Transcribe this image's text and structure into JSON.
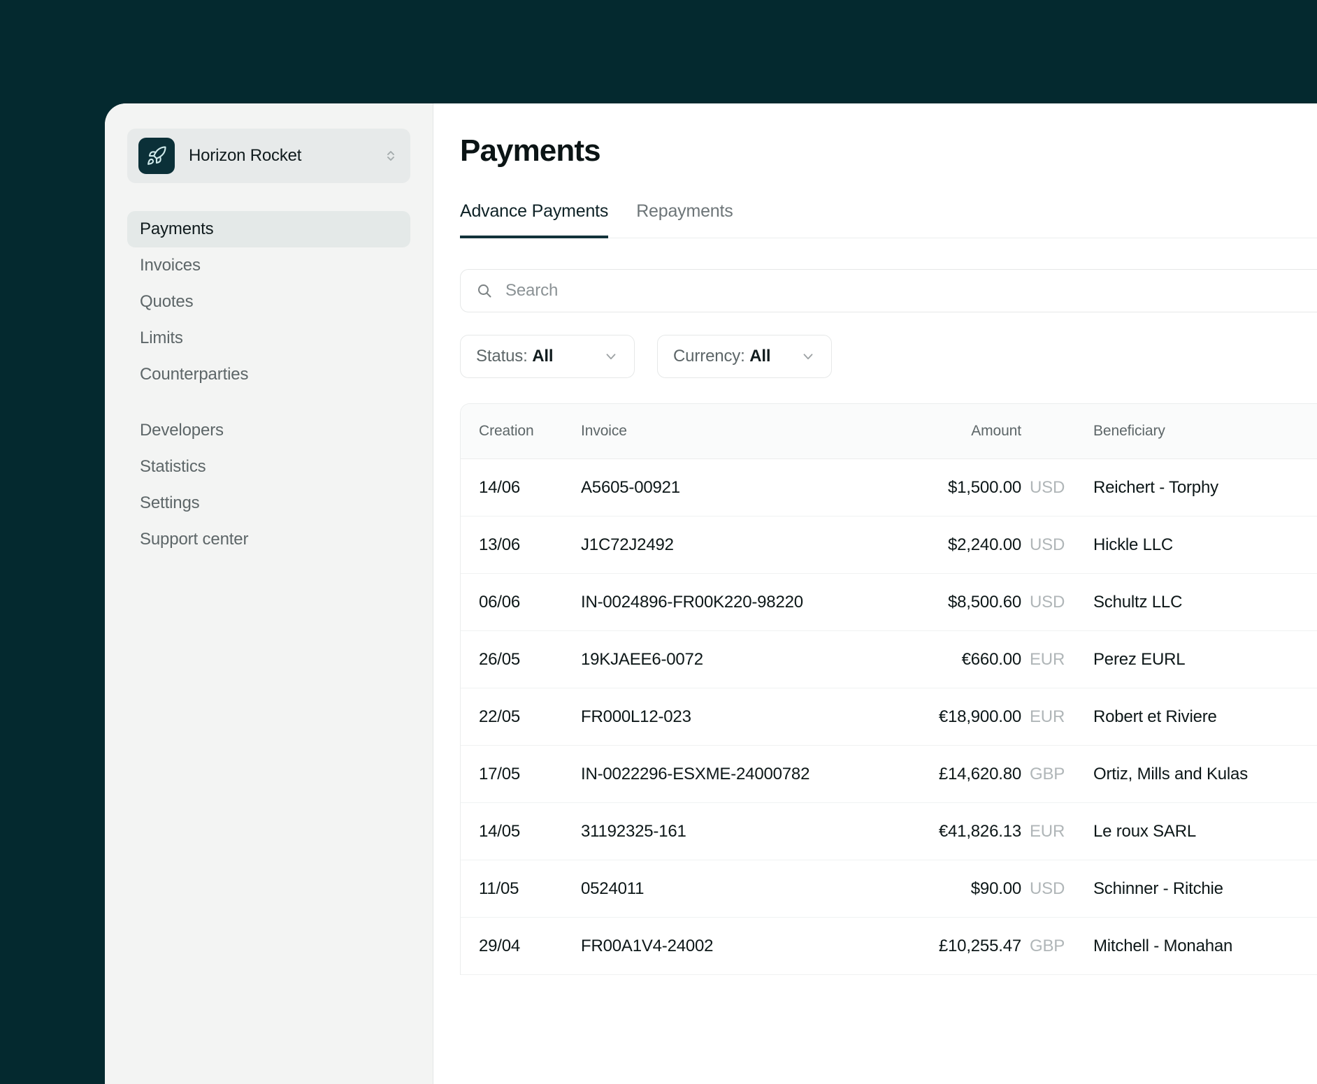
{
  "workspace": {
    "name": "Horizon Rocket",
    "logo_icon": "rocket-icon",
    "switch_icon": "chevron-up-down-icon"
  },
  "sidebar": {
    "primary_items": [
      {
        "label": "Payments",
        "active": true
      },
      {
        "label": "Invoices",
        "active": false
      },
      {
        "label": "Quotes",
        "active": false
      },
      {
        "label": "Limits",
        "active": false
      },
      {
        "label": "Counterparties",
        "active": false
      }
    ],
    "secondary_items": [
      {
        "label": "Developers"
      },
      {
        "label": "Statistics"
      },
      {
        "label": "Settings"
      },
      {
        "label": "Support center"
      }
    ]
  },
  "main": {
    "title": "Payments",
    "tabs": [
      {
        "label": "Advance Payments",
        "active": true
      },
      {
        "label": "Repayments",
        "active": false
      }
    ],
    "search": {
      "placeholder": "Search",
      "value": "",
      "icon": "search-icon"
    },
    "filters": [
      {
        "prefix": "Status: ",
        "value": "All",
        "icon": "chevron-down-icon"
      },
      {
        "prefix": "Currency: ",
        "value": "All",
        "icon": "chevron-down-icon"
      }
    ],
    "table": {
      "columns": [
        "Creation",
        "Invoice",
        "Amount",
        "Beneficiary"
      ],
      "rows": [
        {
          "creation": "14/06",
          "invoice": "A5605-00921",
          "amount": "$1,500.00",
          "currency": "USD",
          "beneficiary": "Reichert - Torphy"
        },
        {
          "creation": "13/06",
          "invoice": "J1C72J2492",
          "amount": "$2,240.00",
          "currency": "USD",
          "beneficiary": "Hickle LLC"
        },
        {
          "creation": "06/06",
          "invoice": "IN-0024896-FR00K220-98220",
          "amount": "$8,500.60",
          "currency": "USD",
          "beneficiary": "Schultz LLC"
        },
        {
          "creation": "26/05",
          "invoice": "19KJAEE6-0072",
          "amount": "€660.00",
          "currency": "EUR",
          "beneficiary": "Perez EURL"
        },
        {
          "creation": "22/05",
          "invoice": "FR000L12-023",
          "amount": "€18,900.00",
          "currency": "EUR",
          "beneficiary": "Robert et Riviere"
        },
        {
          "creation": "17/05",
          "invoice": "IN-0022296-ESXME-24000782",
          "amount": "£14,620.80",
          "currency": "GBP",
          "beneficiary": "Ortiz, Mills and Kulas"
        },
        {
          "creation": "14/05",
          "invoice": "31192325-161",
          "amount": "€41,826.13",
          "currency": "EUR",
          "beneficiary": "Le roux SARL"
        },
        {
          "creation": "11/05",
          "invoice": "0524011",
          "amount": "$90.00",
          "currency": "USD",
          "beneficiary": "Schinner - Ritchie"
        },
        {
          "creation": "29/04",
          "invoice": "FR00A1V4-24002",
          "amount": "£10,255.47",
          "currency": "GBP",
          "beneficiary": "Mitchell - Monahan"
        }
      ]
    }
  },
  "colors": {
    "page_backdrop": "#04292f",
    "sidebar_bg": "#f3f4f3",
    "accent_dark": "#12333a",
    "logo_bg": "#0b3038",
    "logo_glyph": "#cfe9ea"
  }
}
